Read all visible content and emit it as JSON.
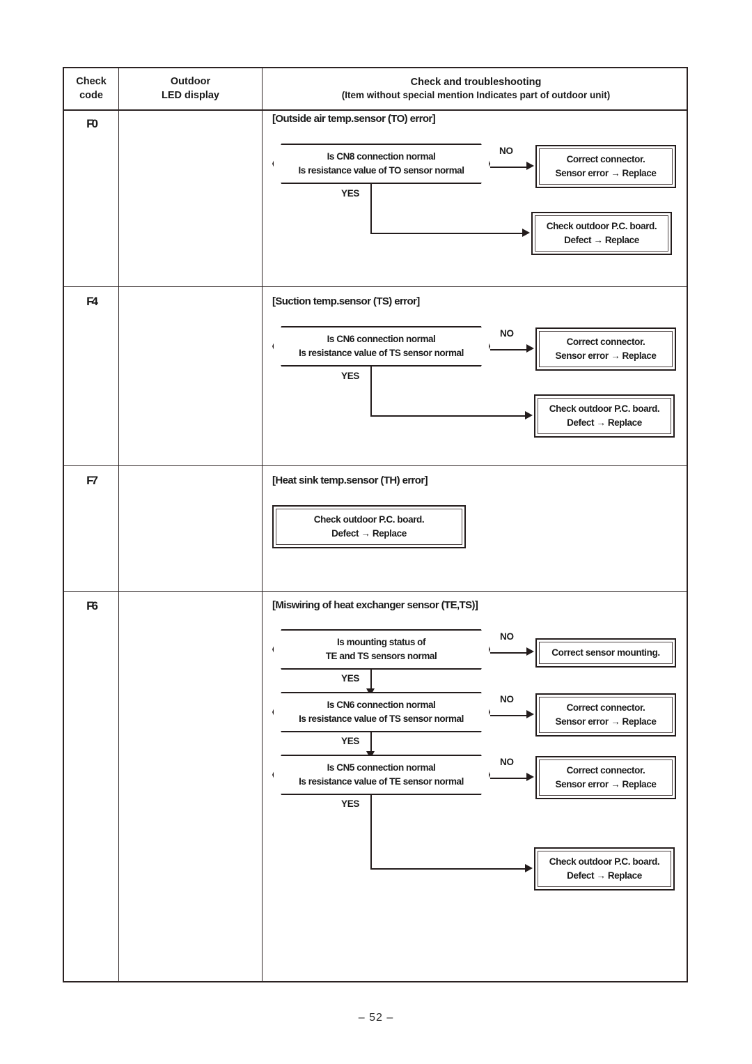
{
  "page": {
    "footer": "– 52 –"
  },
  "table": {
    "headers": {
      "check_code": "Check\ncode",
      "check_code_l1": "Check",
      "check_code_l2": "code",
      "led_display_l1": "Outdoor",
      "led_display_l2": "LED display",
      "troubleshooting_l1": "Check and troubleshooting",
      "troubleshooting_l2": "(Item without special mention Indicates part of outdoor unit)"
    },
    "rows": [
      {
        "check_code": "F0",
        "led_display": "",
        "title": "[Outside air temp.sensor (TO) error]",
        "nodes": {
          "decision1_l1": "Is CN8 connection normal",
          "decision1_l2": "Is resistance value of TO sensor normal",
          "no_label": "NO",
          "yes_label": "YES",
          "action_no_l1": "Correct connector.",
          "action_no_l2": "Sensor error → Replace",
          "action_yes_l1": "Check outdoor P.C. board.",
          "action_yes_l2": "Defect → Replace"
        }
      },
      {
        "check_code": "F4",
        "led_display": "",
        "title": "[Suction temp.sensor (TS) error]",
        "nodes": {
          "decision1_l1": "Is CN6 connection normal",
          "decision1_l2": "Is resistance value of TS sensor normal",
          "no_label": "NO",
          "yes_label": "YES",
          "action_no_l1": "Correct connector.",
          "action_no_l2": "Sensor error → Replace",
          "action_yes_l1": "Check outdoor P.C. board.",
          "action_yes_l2": "Defect → Replace"
        }
      },
      {
        "check_code": "F7",
        "led_display": "",
        "title": "[Heat sink temp.sensor (TH) error]",
        "nodes": {
          "action_l1": "Check outdoor P.C. board.",
          "action_l2": "Defect → Replace"
        }
      },
      {
        "check_code": "F6",
        "led_display": "",
        "title": "[Miswiring of heat exchanger sensor (TE,TS)]",
        "nodes": {
          "decision1_l1": "Is mounting status of",
          "decision1_l2": "TE and TS sensors normal",
          "decision1_no_action": "Correct sensor mounting.",
          "decision2_l1": "Is CN6 connection normal",
          "decision2_l2": "Is resistance value of TS sensor normal",
          "decision2_no_l1": "Correct connector.",
          "decision2_no_l2": "Sensor error → Replace",
          "decision3_l1": "Is CN5 connection normal",
          "decision3_l2": "Is resistance value of TE sensor normal",
          "decision3_no_l1": "Correct connector.",
          "decision3_no_l2": "Sensor error → Replace",
          "final_l1": "Check outdoor P.C. board.",
          "final_l2": "Defect → Replace",
          "no_label": "NO",
          "yes_label": "YES"
        }
      }
    ]
  }
}
